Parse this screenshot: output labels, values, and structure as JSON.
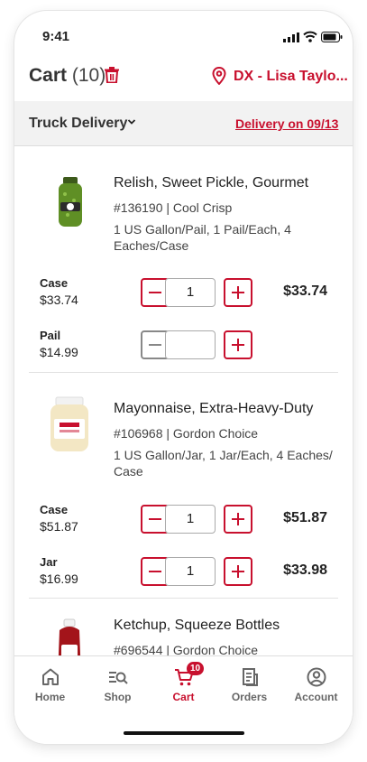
{
  "status_bar": {
    "time": "9:41"
  },
  "header": {
    "title": "Cart",
    "count": "(10)",
    "location": "DX - Lisa Taylo..."
  },
  "delivery": {
    "type": "Truck Delivery",
    "date": "Delivery on 09/13"
  },
  "items": [
    {
      "name": "Relish, Sweet Pickle, Gourmet",
      "meta": "#136190 | Cool Crisp",
      "pack": "1 US Gallon/Pail, 1 Pail/Each, 4 Eaches/Case",
      "units": [
        {
          "unit": "Case",
          "price": "$33.74",
          "qty": "1",
          "total": "$33.74",
          "minus_enabled": true
        },
        {
          "unit": "Pail",
          "price": "$14.99",
          "qty": "",
          "total": "",
          "minus_enabled": false
        }
      ]
    },
    {
      "name": "Mayonnaise, Extra-Heavy-Duty",
      "meta": "#106968 | Gordon Choice",
      "pack": "1 US Gallon/Jar, 1 Jar/Each, 4 Eaches/ Case",
      "units": [
        {
          "unit": "Case",
          "price": "$51.87",
          "qty": "1",
          "total": "$51.87",
          "minus_enabled": true
        },
        {
          "unit": "Jar",
          "price": "$16.99",
          "qty": "1",
          "total": "$33.98",
          "minus_enabled": true
        }
      ]
    },
    {
      "name": "Ketchup, Squeeze Bottles",
      "meta": "#696544 | Gordon Choice"
    }
  ],
  "bottom_nav": [
    {
      "label": "Home",
      "icon": "home-icon"
    },
    {
      "label": "Shop",
      "icon": "shop-search-icon"
    },
    {
      "label": "Cart",
      "icon": "cart-icon",
      "badge": "10",
      "active": true
    },
    {
      "label": "Orders",
      "icon": "orders-icon"
    },
    {
      "label": "Account",
      "icon": "account-icon"
    }
  ],
  "colors": {
    "accent": "#c8102e",
    "bar_bg": "#f2f2f2",
    "text": "#222222",
    "muted": "#666666"
  }
}
